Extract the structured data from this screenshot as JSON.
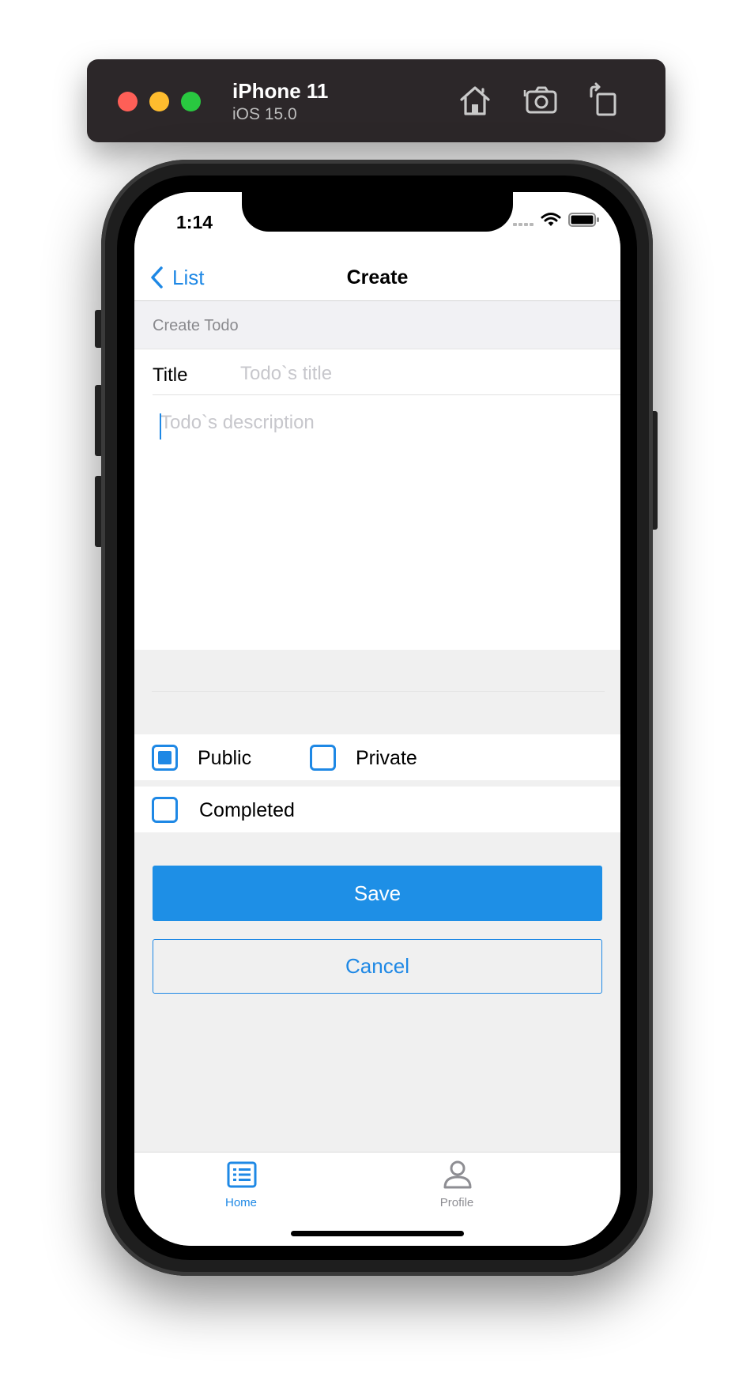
{
  "simulator": {
    "device_name": "iPhone 11",
    "os_version": "iOS 15.0",
    "traffic_colors": [
      "#fe5f57",
      "#febc2e",
      "#29c840"
    ]
  },
  "status_bar": {
    "time": "1:14"
  },
  "nav": {
    "back_label": "List",
    "title": "Create"
  },
  "form": {
    "section_header": "Create Todo",
    "title_label": "Title",
    "title_placeholder": "Todo`s title",
    "title_value": "",
    "description_placeholder": "Todo`s description",
    "description_value": ""
  },
  "visibility": {
    "options": [
      {
        "label": "Public",
        "checked": true
      },
      {
        "label": "Private",
        "checked": false
      }
    ]
  },
  "completed": {
    "label": "Completed",
    "checked": false
  },
  "actions": {
    "save_label": "Save",
    "cancel_label": "Cancel"
  },
  "tabs": [
    {
      "label": "Home",
      "icon": "list-icon",
      "active": true
    },
    {
      "label": "Profile",
      "icon": "person-icon",
      "active": false
    }
  ],
  "colors": {
    "accent": "#1e88e5",
    "inactive_tab": "#8e8e93"
  }
}
